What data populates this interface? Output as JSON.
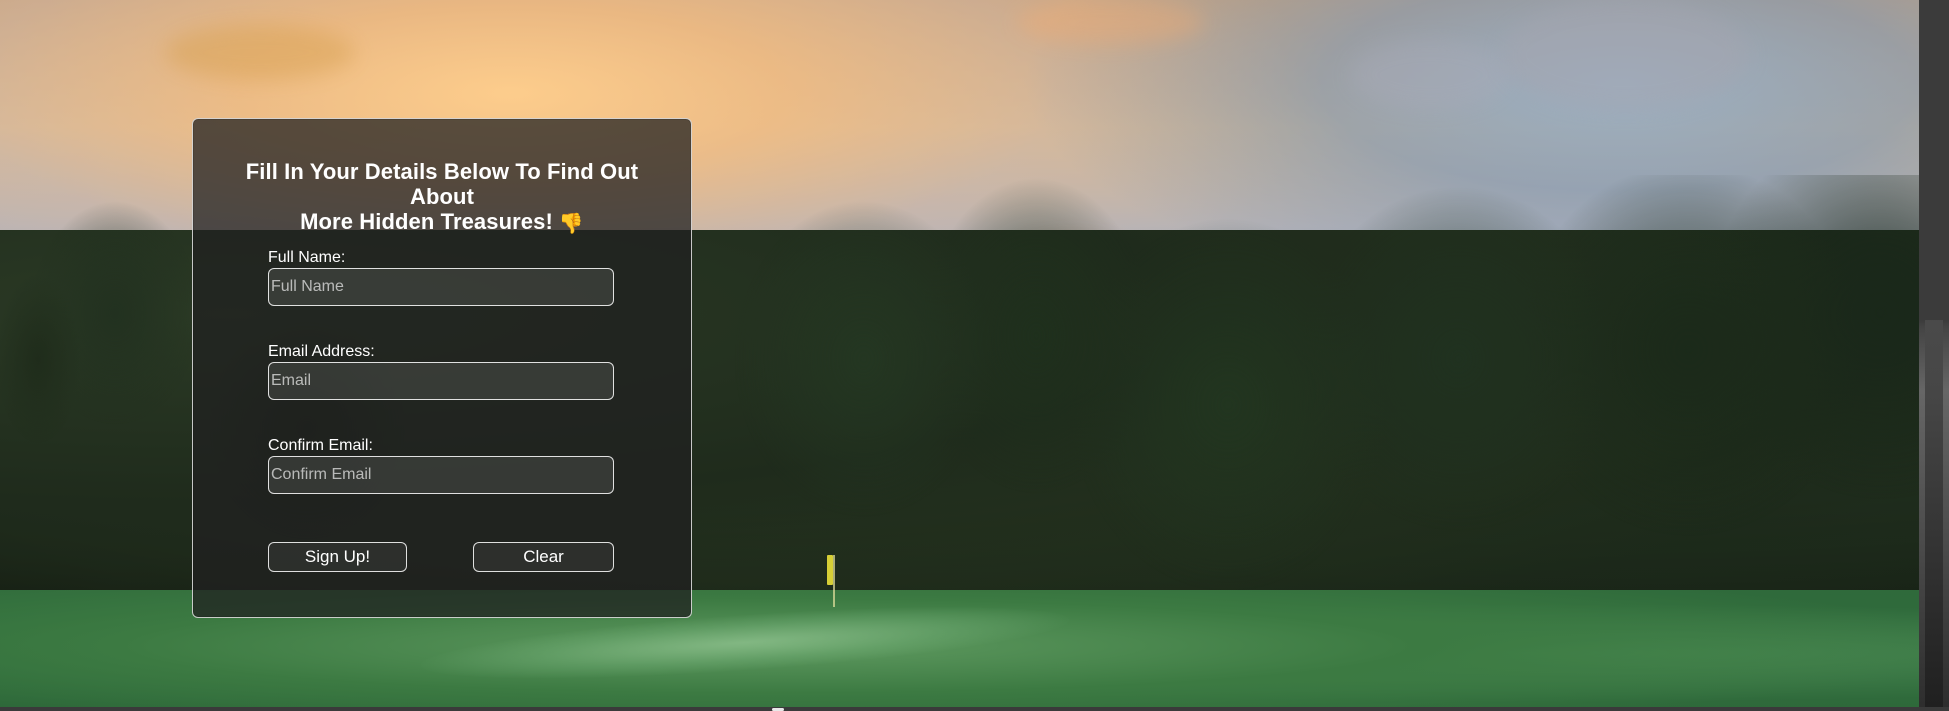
{
  "form": {
    "title_line1": "Fill In Your Details Below To Find Out About",
    "title_line2": "More Hidden Treasures!",
    "title_icon": "👎",
    "full_name": {
      "label": "Full Name:",
      "placeholder": "Full Name",
      "value": ""
    },
    "email": {
      "label": "Email Address:",
      "placeholder": "Email",
      "value": ""
    },
    "confirm_email": {
      "label": "Confirm Email:",
      "placeholder": "Confirm Email",
      "value": ""
    },
    "buttons": {
      "signup": "Sign Up!",
      "clear": "Clear"
    }
  }
}
